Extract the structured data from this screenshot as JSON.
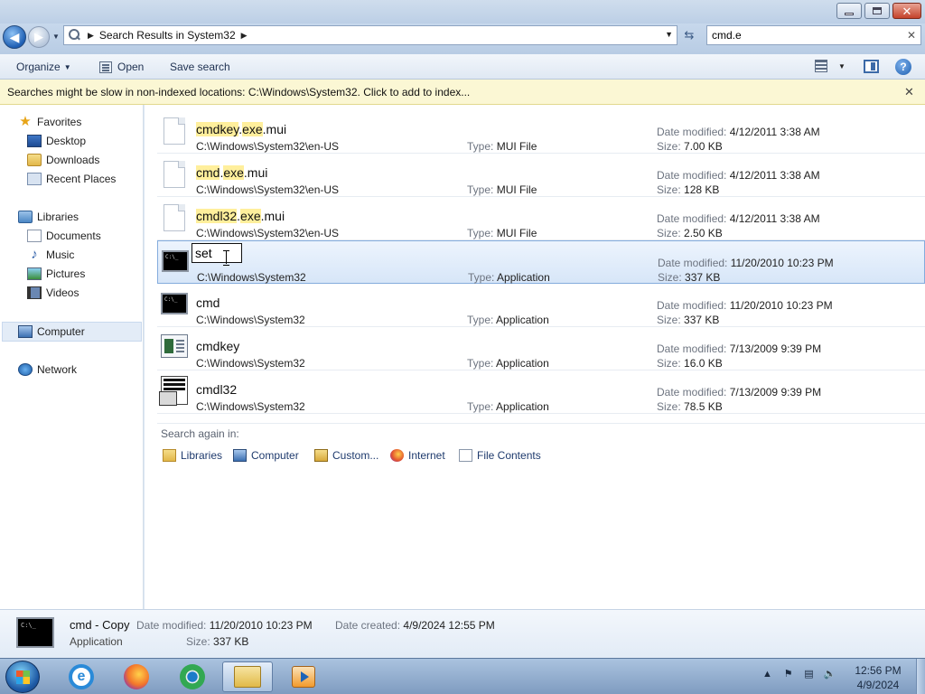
{
  "address": {
    "crumb": "Search Results in System32"
  },
  "search": {
    "query": "cmd.e"
  },
  "toolbar": {
    "organize": "Organize",
    "open": "Open",
    "save_search": "Save search"
  },
  "infobar": {
    "text": "Searches might be slow in non-indexed locations: C:\\Windows\\System32. Click to add to index..."
  },
  "nav": {
    "favorites": "Favorites",
    "desktop": "Desktop",
    "downloads": "Downloads",
    "recent_places": "Recent Places",
    "libraries": "Libraries",
    "documents": "Documents",
    "music": "Music",
    "pictures": "Pictures",
    "videos": "Videos",
    "computer": "Computer",
    "network": "Network"
  },
  "labels": {
    "date_modified": "Date modified:",
    "size": "Size:",
    "type": "Type:",
    "date_created": "Date created:"
  },
  "results": [
    {
      "name_hl1": "cmdkey",
      "name_mid": ".",
      "name_hl2": "exe",
      "name_rest": ".mui",
      "path": "C:\\Windows\\System32\\en-US",
      "type": "MUI File",
      "date": "4/12/2011 3:38 AM",
      "size": "7.00 KB"
    },
    {
      "name_hl1": "cmd",
      "name_mid": ".",
      "name_hl2": "exe",
      "name_rest": ".mui",
      "path": "C:\\Windows\\System32\\en-US",
      "type": "MUI File",
      "date": "4/12/2011 3:38 AM",
      "size": "128 KB"
    },
    {
      "name_hl1": "cmdl32",
      "name_mid": ".",
      "name_hl2": "exe",
      "name_rest": ".mui",
      "path": "C:\\Windows\\System32\\en-US",
      "type": "MUI File",
      "date": "4/12/2011 3:38 AM",
      "size": "2.50 KB"
    },
    {
      "rename_value": "set",
      "path": "C:\\Windows\\System32",
      "type": "Application",
      "date": "11/20/2010 10:23 PM",
      "size": "337 KB"
    },
    {
      "name": "cmd",
      "path": "C:\\Windows\\System32",
      "type": "Application",
      "date": "11/20/2010 10:23 PM",
      "size": "337 KB"
    },
    {
      "name": "cmdkey",
      "path": "C:\\Windows\\System32",
      "type": "Application",
      "date": "7/13/2009 9:39 PM",
      "size": "16.0 KB"
    },
    {
      "name": "cmdl32",
      "path": "C:\\Windows\\System32",
      "type": "Application",
      "date": "7/13/2009 9:39 PM",
      "size": "78.5 KB"
    }
  ],
  "search_again": {
    "label": "Search again in:",
    "libraries": "Libraries",
    "computer": "Computer",
    "custom": "Custom...",
    "internet": "Internet",
    "file_contents": "File Contents"
  },
  "details": {
    "name": "cmd - Copy",
    "kind": "Application",
    "date_modified": "11/20/2010 10:23 PM",
    "date_created": "4/9/2024 12:55 PM",
    "size": "337 KB",
    "icon_text": "C:\\_"
  },
  "cmd_icon_text": "C:\\_",
  "clock": {
    "time": "12:56 PM",
    "date": "4/9/2024"
  }
}
